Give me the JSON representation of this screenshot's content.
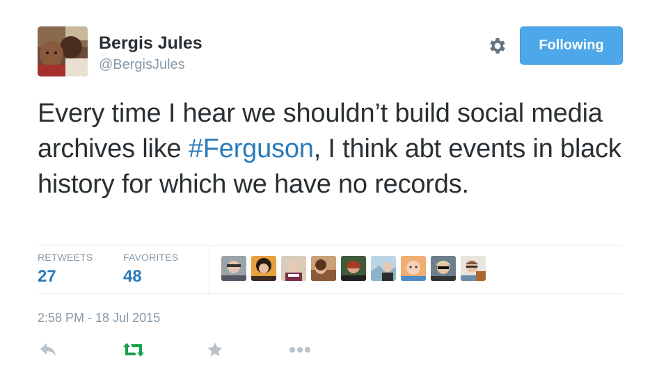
{
  "user": {
    "name": "Bergis Jules",
    "handle": "@BergisJules"
  },
  "follow_button": {
    "label": "Following"
  },
  "tweet": {
    "text_before": "Every time I hear we shouldn’t build social media archives like ",
    "hashtag": "#Ferguson",
    "text_after": ", I think abt events in black history for which we have no records."
  },
  "stats": {
    "retweets_label": "RETWEETS",
    "retweets_count": "27",
    "favorites_label": "FAVORITES",
    "favorites_count": "48"
  },
  "favoriters": [
    {
      "avatar": "favoriter-avatar-1"
    },
    {
      "avatar": "favoriter-avatar-2"
    },
    {
      "avatar": "favoriter-avatar-3"
    },
    {
      "avatar": "favoriter-avatar-4"
    },
    {
      "avatar": "favoriter-avatar-5"
    },
    {
      "avatar": "favoriter-avatar-6"
    },
    {
      "avatar": "favoriter-avatar-7"
    },
    {
      "avatar": "favoriter-avatar-8"
    },
    {
      "avatar": "favoriter-avatar-9"
    }
  ],
  "timestamp": "2:58 PM - 18 Jul 2015",
  "actions": {
    "reply_icon": "reply-icon",
    "retweet_icon": "retweet-icon",
    "favorite_icon": "star-icon",
    "more_icon": "more-icon"
  },
  "colors": {
    "link": "#2b7bb9",
    "follow_button": "#4ea7e8",
    "retweet_active": "#19a14a",
    "muted": "#8899a6",
    "icon_muted": "#b7c2ca"
  }
}
